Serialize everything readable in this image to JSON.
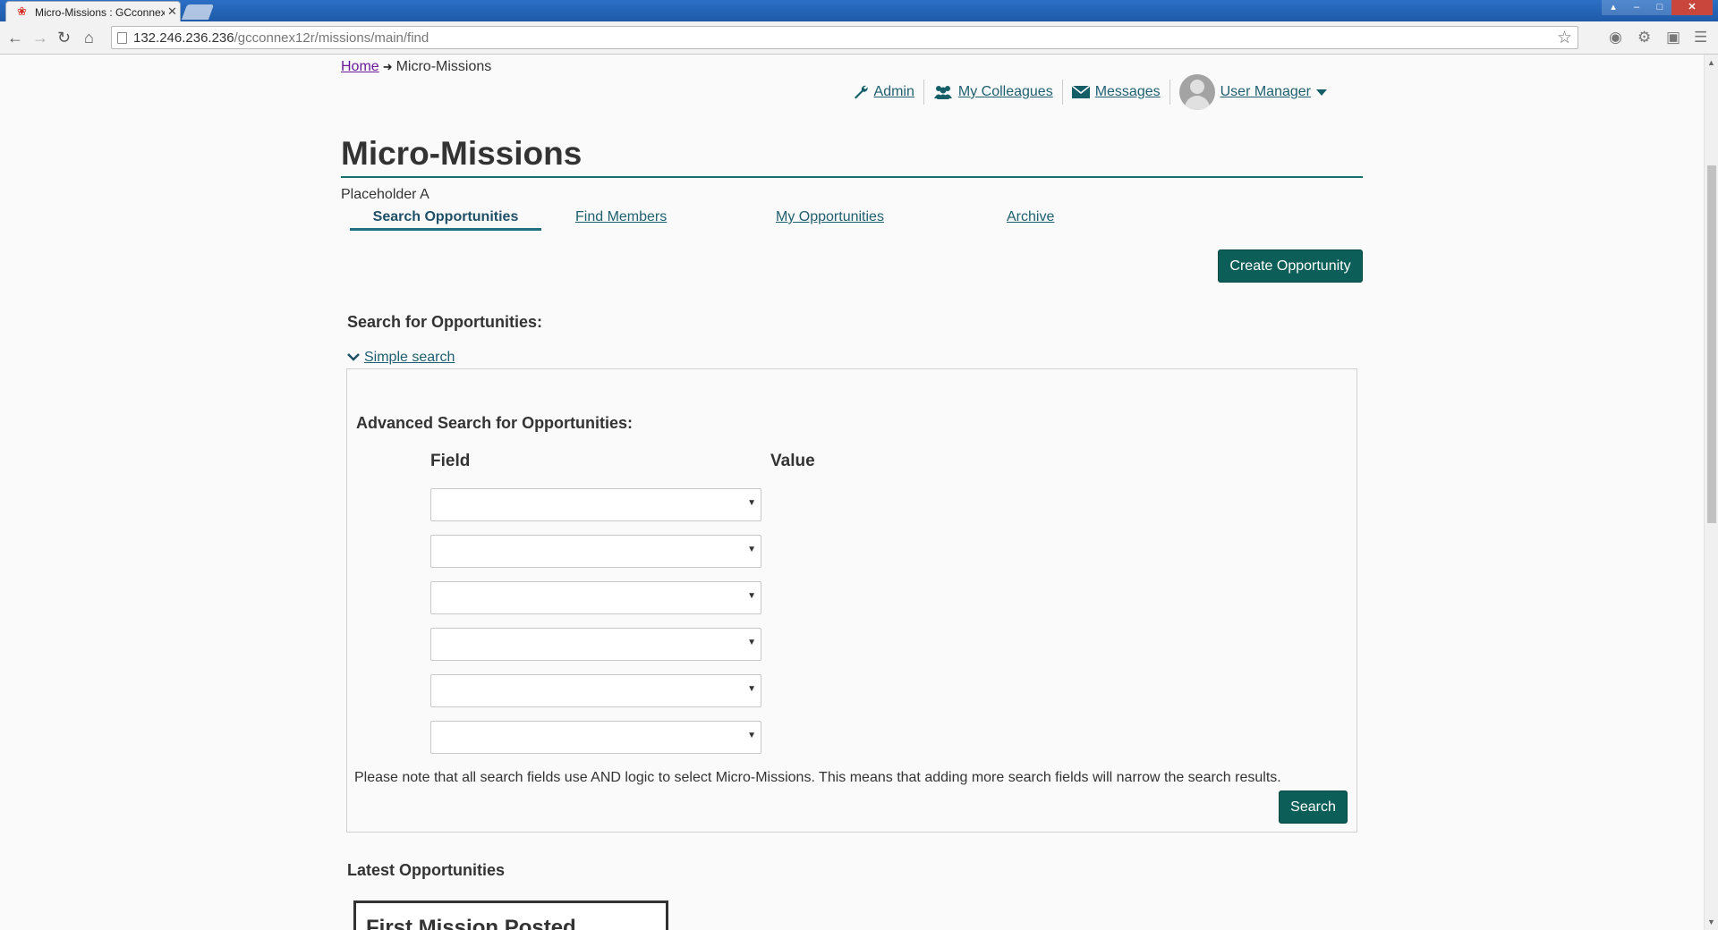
{
  "browser": {
    "tab_title": "Micro-Missions : GCconnex",
    "url_host": "132.246.236.236",
    "url_path": "/gcconnex12r/missions/main/find"
  },
  "breadcrumb": {
    "home": "Home",
    "current": "Micro-Missions"
  },
  "usernav": {
    "admin": "Admin",
    "colleagues": "My Colleagues",
    "messages": "Messages",
    "user": "User Manager"
  },
  "page": {
    "title": "Micro-Missions",
    "placeholder": "Placeholder A"
  },
  "tabs": [
    {
      "label": "Search Opportunities",
      "active": true
    },
    {
      "label": "Find Members",
      "active": false
    },
    {
      "label": "My Opportunities",
      "active": false
    },
    {
      "label": "Archive",
      "active": false
    }
  ],
  "create_button": "Create Opportunity",
  "search": {
    "heading": "Search for Opportunities:",
    "simple_toggle": "Simple search",
    "advanced_heading": "Advanced Search for Opportunities:",
    "field_col": "Field",
    "value_col": "Value",
    "selects": [
      "",
      "",
      "",
      "",
      "",
      ""
    ],
    "note": "Please note that all search fields use AND logic to select Micro-Missions. This means that adding more search fields will narrow the search results.",
    "button": "Search"
  },
  "latest": {
    "heading": "Latest Opportunities",
    "first_card_title": "First Mission Posted"
  },
  "colors": {
    "accent": "#0b5f58",
    "link": "#1f5f6f",
    "visited": "#6a1b9a"
  }
}
